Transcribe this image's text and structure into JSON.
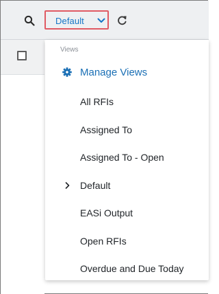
{
  "toolbar": {
    "search_icon": "search-icon",
    "view_select_label": "Default",
    "chevron_icon": "chevron-down-icon",
    "refresh_icon": "refresh-icon",
    "highlight_color": "#e05a63",
    "link_color": "#1575c6"
  },
  "menu": {
    "header": "Views",
    "manage_label": "Manage Views",
    "manage_icon": "gear-icon",
    "items": [
      {
        "label": "All RFIs"
      },
      {
        "label": "Assigned To"
      },
      {
        "label": "Assigned To - Open"
      },
      {
        "label": "Default",
        "current": true
      },
      {
        "label": "EASi Output"
      },
      {
        "label": "Open RFIs"
      },
      {
        "label": "Overdue and Due Today"
      }
    ]
  }
}
